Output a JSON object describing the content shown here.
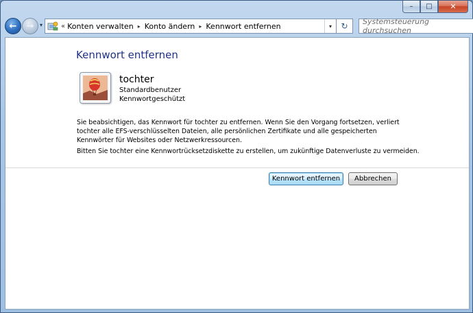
{
  "window": {
    "caption_buttons": {
      "minimize": "–",
      "maximize": "□",
      "close": "✕"
    }
  },
  "nav": {
    "back_label": "←",
    "forward_label": "→",
    "dropdown": "▾"
  },
  "address_bar": {
    "overflow": "«",
    "breadcrumbs": [
      {
        "label": "Konten verwalten"
      },
      {
        "label": "Konto ändern"
      },
      {
        "label": "Kennwort entfernen"
      }
    ],
    "separator": "▸",
    "dropdown": "▾",
    "refresh": "↻"
  },
  "search": {
    "placeholder": "Systemsteuerung durchsuchen"
  },
  "page": {
    "title": "Kennwort entfernen",
    "user": {
      "name": "tochter",
      "type": "Standardbenutzer",
      "protection": "Kennwortgeschützt"
    },
    "paragraph1": "Sie beabsichtigen, das Kennwort für tochter zu entfernen. Wenn Sie den Vorgang fortsetzen, verliert tochter alle EFS-verschlüsselten Dateien, alle persönlichen Zertifikate und alle gespeicherten Kennwörter für Websites oder Netzwerkressourcen.",
    "paragraph2": "Bitten Sie tochter eine Kennwortrücksetzdiskette zu erstellen, um zukünftige Datenverluste zu vermeiden."
  },
  "buttons": {
    "remove": "Kennwort entfernen",
    "cancel": "Abbrechen"
  },
  "colors": {
    "title_blue": "#1e3287",
    "window_frame": "#a9c6e6",
    "close_red": "#c74427"
  }
}
